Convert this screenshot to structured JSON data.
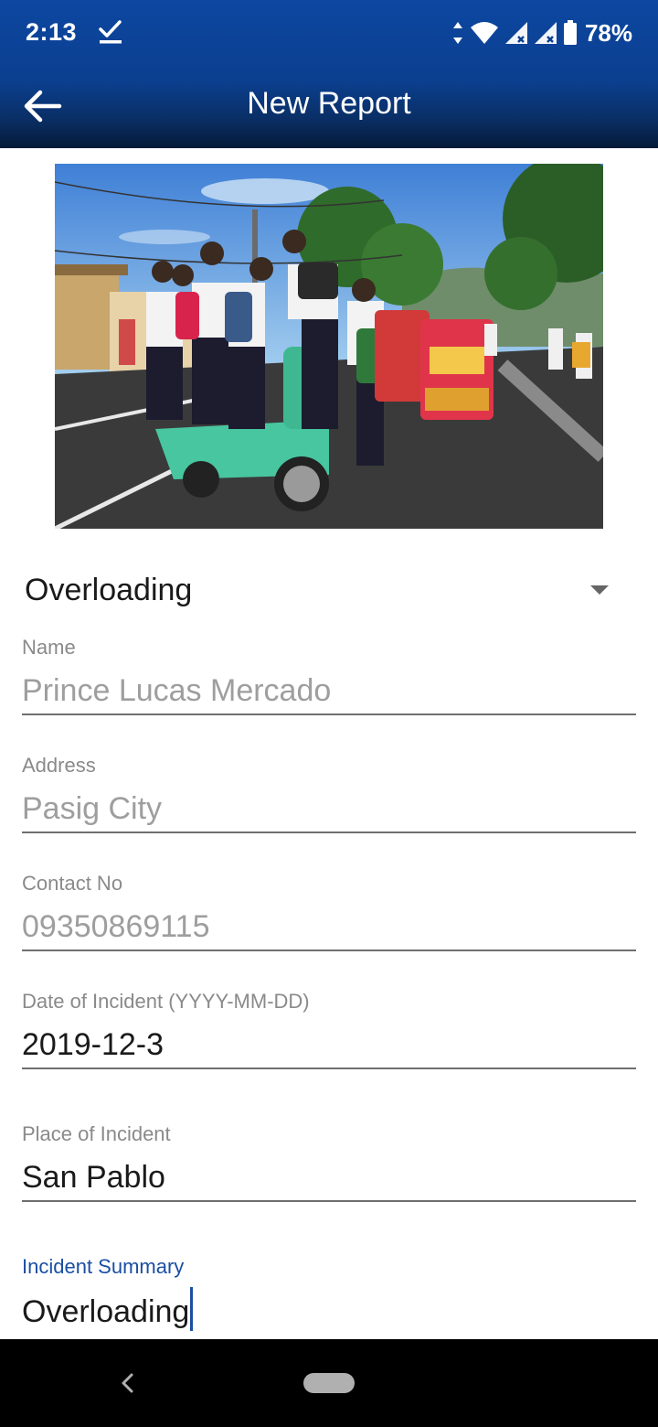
{
  "status_bar": {
    "time": "2:13",
    "battery_percent": "78%",
    "icons": [
      "check-icon",
      "data-arrows-icon",
      "wifi-icon",
      "signal-icon",
      "signal-icon",
      "battery-icon"
    ]
  },
  "app_bar": {
    "title": "New Report",
    "back_icon": "arrow-left-icon"
  },
  "colors": {
    "primary": "#0d47a1",
    "accent": "#1a4fa3",
    "text": "#1a1a1a",
    "hint": "#9e9e9e"
  },
  "incident_type": {
    "selected": "Overloading"
  },
  "form": {
    "name": {
      "label": "Name",
      "value": "Prince Lucas Mercado"
    },
    "address": {
      "label": "Address",
      "value": "Pasig City"
    },
    "contact": {
      "label": "Contact No",
      "value": "09350869115"
    },
    "date": {
      "label": "Date of Incident (YYYY-MM-DD)",
      "value": "2019-12-3"
    },
    "place": {
      "label": "Place of Incident",
      "value": "San Pablo"
    },
    "summary": {
      "label": "Incident Summary",
      "value": "Overloading"
    }
  }
}
